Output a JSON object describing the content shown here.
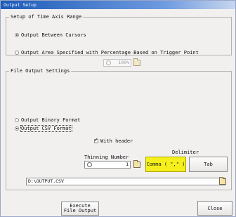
{
  "window": {
    "title": "Output Setup"
  },
  "time_axis": {
    "legend": "Setup of Time Axis Range",
    "opt_cursors": "Output Between Cursors",
    "opt_percentage": "Output Area Specified with Percentage Based on Trigger Point",
    "percentage_value": "100%"
  },
  "file_settings": {
    "legend": "File Output Settings",
    "opt_binary": "Output Binary Format",
    "opt_csv": "Output CSV Format",
    "with_header": "With header",
    "thinning_label": "Thinning Number",
    "thinning_value": "1",
    "delimiter_label": "Delimiter",
    "comma_label": "Comma ( \",\" )",
    "tab_label": "Tab",
    "path_value": "D:\\OUTPUT.CSV"
  },
  "buttons": {
    "execute_line1": "Execute",
    "execute_line2": "File Output",
    "close": "Close"
  },
  "colors": {
    "title_bar": "#1d5bb8",
    "selected_delimiter": "#f5f01c"
  },
  "icons": [
    "folder-browse-icon",
    "spinner-knob-icon"
  ]
}
